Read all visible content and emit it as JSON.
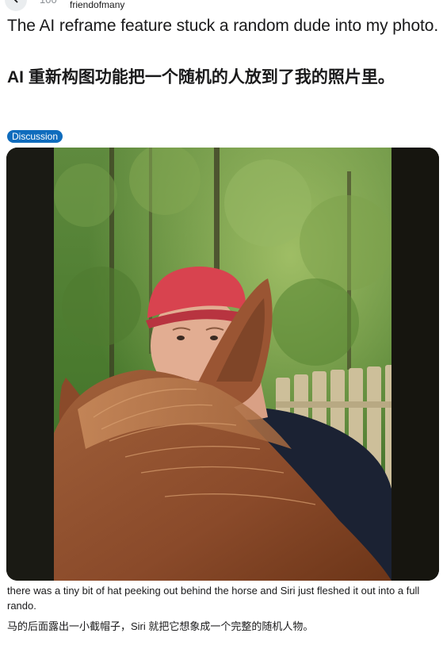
{
  "header": {
    "subreddit_member_count": "100",
    "author": "friendofmany",
    "back_icon": "arrow-left-icon"
  },
  "post": {
    "title_en": "The AI reframe feature stuck a random dude into my photo.",
    "title_zh": "AI 重新构图功能把一个随机的人放到了我的照片里。",
    "flair": "Discussion",
    "flair_color": "#0f6cbd",
    "body_en": "there was a tiny bit of hat peeking out behind the horse and Siri just fleshed it out into a full rando.",
    "body_zh": "马的后面露出一小截帽子，Siri 就把它想象成一个完整的随机人物。"
  },
  "image": {
    "description_elements": [
      "trees",
      "man-in-red-cap",
      "wooden-fence",
      "horse-head"
    ],
    "cap_color": "#d8434f",
    "shirt_color": "#1b2233",
    "horse_color": "#8a4a2a"
  }
}
